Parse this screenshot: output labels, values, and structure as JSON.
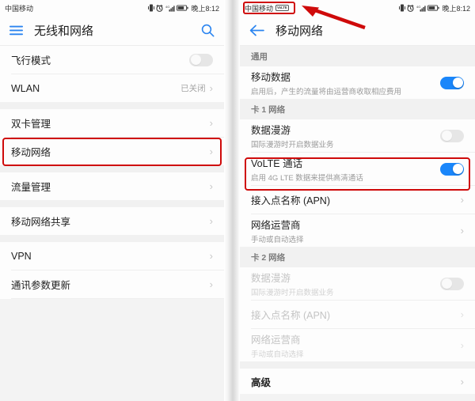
{
  "left_phone": {
    "status_bar": {
      "carrier": "中国移动",
      "time": "晚上8:12",
      "icons": [
        "vibrate-icon",
        "alarm-icon",
        "signal-icon",
        "battery-icon"
      ]
    },
    "app_bar": {
      "title": "无线和网络",
      "menu_icon": "hamburger-menu-icon",
      "search_icon": "search-icon"
    },
    "groups": [
      {
        "rows": [
          {
            "label": "飞行模式",
            "type": "toggle",
            "toggle": "off"
          },
          {
            "label": "WLAN",
            "type": "value",
            "value": "已关闭"
          }
        ]
      },
      {
        "rows": [
          {
            "label": "双卡管理",
            "type": "link"
          },
          {
            "label": "移动网络",
            "type": "link",
            "highlighted": true
          }
        ]
      },
      {
        "rows": [
          {
            "label": "流量管理",
            "type": "link"
          }
        ]
      },
      {
        "rows": [
          {
            "label": "移动网络共享",
            "type": "link"
          }
        ]
      },
      {
        "rows": [
          {
            "label": "VPN",
            "type": "link"
          },
          {
            "label": "通讯参数更新",
            "type": "link"
          }
        ]
      }
    ]
  },
  "right_phone": {
    "status_bar": {
      "carrier": "中国移动",
      "carrier_badge": "VoLTE",
      "time": "晚上8:12",
      "icons": [
        "vibrate-icon",
        "alarm-icon",
        "signal-icon",
        "battery-icon"
      ]
    },
    "app_bar": {
      "title": "移动网络",
      "back_icon": "back-arrow-icon"
    },
    "sections": [
      {
        "header": "通用",
        "rows": [
          {
            "label": "移动数据",
            "sub": "启用后，产生的流量将由运营商收取相应费用",
            "type": "toggle",
            "toggle": "on"
          }
        ]
      },
      {
        "header": "卡 1 网络",
        "rows": [
          {
            "label": "数据漫游",
            "sub": "国际漫游时开启数据业务",
            "type": "toggle",
            "toggle": "off"
          },
          {
            "label": "VoLTE 通话",
            "sub": "启用 4G LTE 数据来提供高清通话",
            "type": "toggle",
            "toggle": "on",
            "highlighted": true
          },
          {
            "label": "接入点名称 (APN)",
            "type": "link"
          },
          {
            "label": "网络运营商",
            "sub": "手动或自动选择",
            "type": "link"
          }
        ]
      },
      {
        "header": "卡 2 网络",
        "rows": [
          {
            "label": "数据漫游",
            "sub": "国际漫游时开启数据业务",
            "type": "toggle",
            "toggle": "off",
            "disabled": true
          },
          {
            "label": "接入点名称 (APN)",
            "type": "link",
            "disabled": true
          },
          {
            "label": "网络运营商",
            "sub": "手动或自动选择",
            "type": "link",
            "disabled": true
          }
        ]
      },
      {
        "header": "",
        "rows": [
          {
            "label": "高级",
            "type": "link",
            "bold": true
          }
        ]
      }
    ]
  },
  "annotations": {
    "highlight_color": "#cf0a0a",
    "arrow": {
      "name": "pointer-arrow",
      "target": "carrier-badge"
    }
  }
}
